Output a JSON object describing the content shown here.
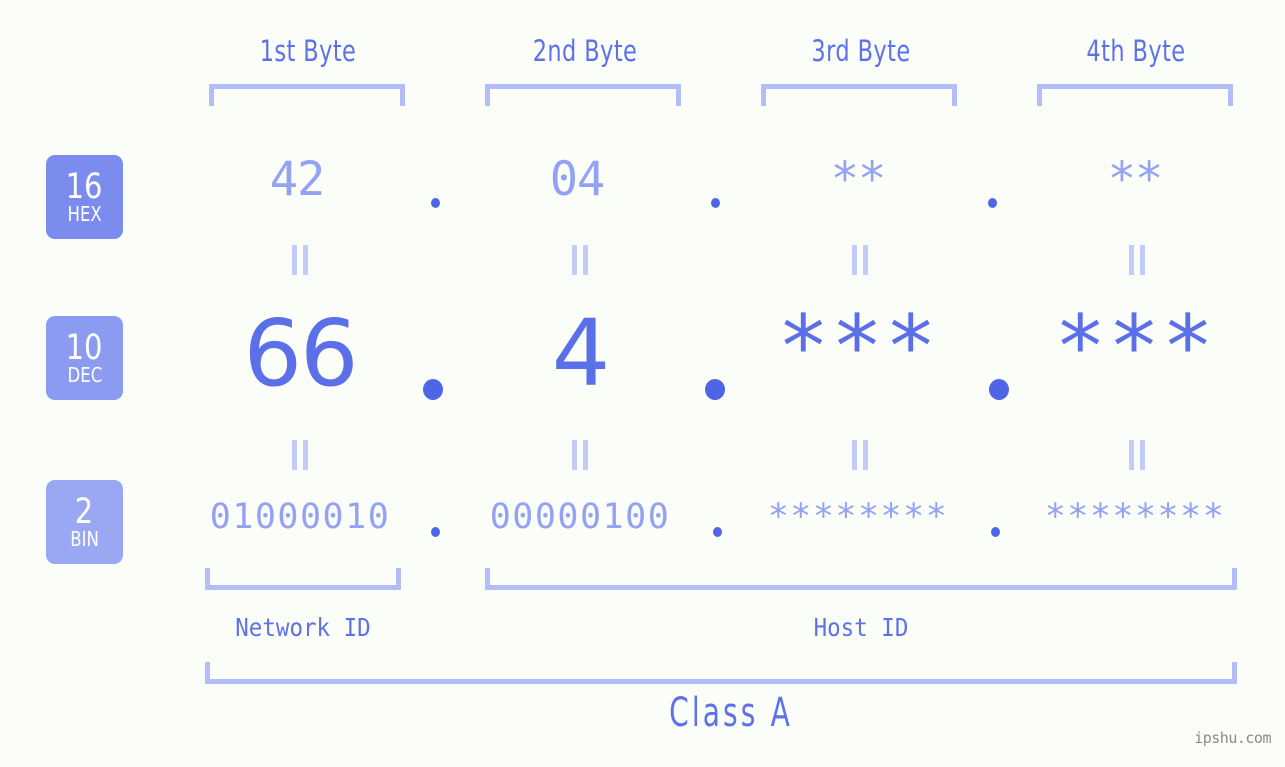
{
  "meta": {
    "background": "#fbfdf9",
    "accent_dark": "#4e66e6",
    "accent_mid": "#5a6fe8",
    "accent_light": "#93a2f2",
    "accent_pale": "#b3bdf7",
    "watermark": "ipshu.com"
  },
  "headers": [
    {
      "label": "1st Byte"
    },
    {
      "label": "2nd Byte"
    },
    {
      "label": "3rd Byte"
    },
    {
      "label": "4th Byte"
    }
  ],
  "bases": [
    {
      "number": "16",
      "abbr": "HEX",
      "color": "#7b8cee"
    },
    {
      "number": "10",
      "abbr": "DEC",
      "color": "#8c9bf2"
    },
    {
      "number": "2",
      "abbr": "BIN",
      "color": "#9aa8f4"
    }
  ],
  "rows": {
    "hex": {
      "values": [
        "42",
        "04",
        "**",
        "**"
      ]
    },
    "dec": {
      "values": [
        "66",
        "4",
        "***",
        "***"
      ]
    },
    "bin": {
      "values": [
        "01000010",
        "00000100",
        "********",
        "********"
      ]
    }
  },
  "separators": {
    "dot": ".",
    "equals": "="
  },
  "sections": [
    {
      "label": "Network ID"
    },
    {
      "label": "Host ID"
    }
  ],
  "class": {
    "label": "Class A"
  }
}
